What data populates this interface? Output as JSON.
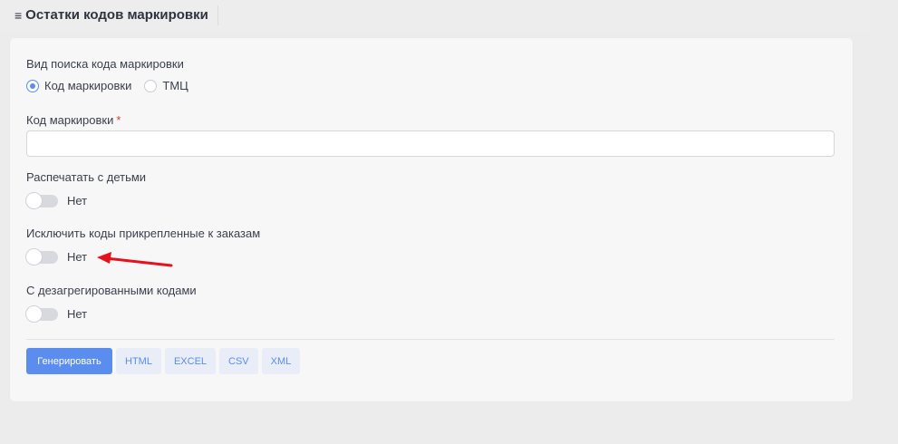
{
  "header": {
    "title": "Остатки кодов маркировки",
    "menu_icon": "hamburger-icon"
  },
  "form": {
    "search_type": {
      "label": "Вид поиска кода маркировки",
      "options": [
        "Код маркировки",
        "ТМЦ"
      ],
      "selected": "Код маркировки"
    },
    "code": {
      "label": "Код маркировки",
      "required_mark": "*",
      "value": "",
      "placeholder": ""
    },
    "print_children": {
      "label": "Распечатать с детьми",
      "state_label": "Нет",
      "checked": false
    },
    "exclude_attached": {
      "label": "Исключить коды прикрепленные к заказам",
      "state_label": "Нет",
      "checked": false
    },
    "disaggregated": {
      "label": "С дезагрегированными кодами",
      "state_label": "Нет",
      "checked": false
    }
  },
  "actions": {
    "generate": "Генерировать",
    "html": "HTML",
    "excel": "EXCEL",
    "csv": "CSV",
    "xml": "XML"
  },
  "colors": {
    "accent": "#5b8def",
    "required": "#e53935",
    "annotation_arrow": "#e8101a"
  }
}
